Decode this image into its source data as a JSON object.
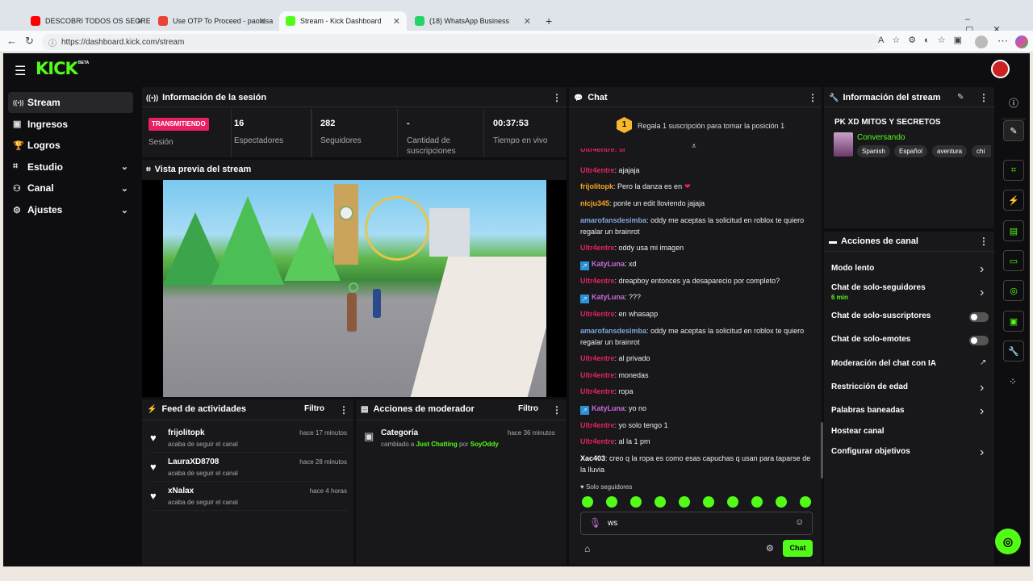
{
  "browser": {
    "tabs": [
      {
        "title": "DESCOBRI TODOS OS SEGREDOS",
        "icon": "youtube-icon",
        "color": "#ff0000"
      },
      {
        "title": "Use OTP To Proceed - paolosancoh",
        "icon": "gmail-icon",
        "color": "#ea4335"
      },
      {
        "title": "Stream - Kick Dashboard",
        "icon": "kick-icon",
        "color": "#53fc18"
      },
      {
        "title": "(18) WhatsApp Business",
        "icon": "whatsapp-icon",
        "color": "#25d366"
      }
    ],
    "url": "https://dashboard.kick.com/stream"
  },
  "brand": {
    "logo": "KICK",
    "badge": "BETA",
    "accent": "#53fc18"
  },
  "sidebar": {
    "items": [
      {
        "label": "Stream",
        "icon": "broadcast-icon"
      },
      {
        "label": "Ingresos",
        "icon": "wallet-icon"
      },
      {
        "label": "Logros",
        "icon": "trophy-icon"
      },
      {
        "label": "Estudio",
        "icon": "studio-icon"
      },
      {
        "label": "Canal",
        "icon": "channel-icon"
      },
      {
        "label": "Ajustes",
        "icon": "gear-icon"
      }
    ]
  },
  "session": {
    "title": "Información de la sesión",
    "status_badge": "TRANSMITIENDO",
    "status_label": "Sesión",
    "stats": [
      {
        "value": "16",
        "label": "Espectadores"
      },
      {
        "value": "282",
        "label": "Seguidores"
      },
      {
        "value": "-",
        "label": "Cantidad de suscripciones"
      },
      {
        "value": "00:37:53",
        "label": "Tiempo en vivo"
      }
    ]
  },
  "preview": {
    "title": "Vista previa del stream"
  },
  "feed": {
    "title": "Feed de actividades",
    "filter": "Filtro",
    "items": [
      {
        "name": "frijolitopk",
        "sub": "acaba de seguir el canal",
        "time": "hace 17 minutos"
      },
      {
        "name": "LauraXD8708",
        "sub": "acaba de seguir el canal",
        "time": "hace 28 minutos"
      },
      {
        "name": "xNalax",
        "sub": "acaba de seguir el canal",
        "time": "hace 4 horas"
      }
    ]
  },
  "modactions": {
    "title": "Acciones de moderador",
    "filter": "Filtro",
    "item": {
      "title": "Categoría",
      "pre": "cambiado a",
      "category": "Just Chatting",
      "by": "por",
      "user": "SoyOddy",
      "time": "hace 36 minutos"
    }
  },
  "chat": {
    "title": "Chat",
    "pinned_rank": "1",
    "pinned_text": "Regala 1 suscripción para tomar la posición 1",
    "messages": [
      {
        "user": "Ultr4entre",
        "text": "ajajaja",
        "color": "#e0245e"
      },
      {
        "user": "frijolitopk",
        "text": "Pero la danza es en",
        "color": "#f5a623"
      },
      {
        "user": "nicju345",
        "text": "ponle un edit lloviendo jajaja",
        "color": "#f5a623"
      },
      {
        "user": "amarofansdesimba",
        "text": "oddy me aceptas la solicitud en roblox te quiero regalar un brainrot",
        "color": "#7ea6e0"
      },
      {
        "user": "Ultr4entre",
        "text": "oddy usa mi imagen",
        "color": "#e0245e"
      },
      {
        "user": "KatyLuna",
        "text": "xd",
        "color": "#c86dd7"
      },
      {
        "user": "Ultr4entre",
        "text": "dreapboy entonces ya desaparecio por completo?",
        "color": "#e0245e"
      },
      {
        "user": "KatyLuna",
        "text": "???",
        "color": "#c86dd7"
      },
      {
        "user": "Ultr4entre",
        "text": "en whasapp",
        "color": "#e0245e"
      },
      {
        "user": "amarofansdesimba",
        "text": "oddy me aceptas la solicitud en roblox te quiero regalar un brainrot",
        "color": "#7ea6e0"
      },
      {
        "user": "Ultr4entre",
        "text": "al privado",
        "color": "#e0245e"
      },
      {
        "user": "Ultr4entre",
        "text": "monedas",
        "color": "#e0245e"
      },
      {
        "user": "Ultr4entre",
        "text": "ropa",
        "color": "#e0245e"
      },
      {
        "user": "KatyLuna",
        "text": "yo no",
        "color": "#c86dd7"
      },
      {
        "user": "Ultr4entre",
        "text": "yo solo tengo 1",
        "color": "#e0245e"
      },
      {
        "user": "Ultr4entre",
        "text": "al la 1 pm",
        "color": "#e0245e"
      },
      {
        "user": "Xac403",
        "text": "creo q la ropa es como esas capuchas q usan para taparse de la lluvia",
        "color": "#ffffff"
      }
    ],
    "followers_only": "Solo seguidores",
    "input_value": "ws",
    "send_label": "Chat"
  },
  "streaminfo": {
    "title": "Información del stream",
    "stream_title": "PK XD MITOS Y SECRETOS",
    "category": "Conversando",
    "tags": [
      "Spanish",
      "Español",
      "aventura",
      "chi"
    ]
  },
  "channel_actions": {
    "title": "Acciones de canal",
    "items": [
      {
        "label": "Modo lento",
        "sub": "",
        "control": "arrow"
      },
      {
        "label": "Chat de solo-seguidores",
        "sub": "6 min",
        "control": "arrow"
      },
      {
        "label": "Chat de solo-suscriptores",
        "sub": "",
        "control": "toggle"
      },
      {
        "label": "Chat de solo-emotes",
        "sub": "",
        "control": "toggle"
      },
      {
        "label": "Moderación del chat con IA",
        "sub": "",
        "control": "external"
      },
      {
        "label": "Restricción de edad",
        "sub": "",
        "control": "arrow"
      },
      {
        "label": "Palabras baneadas",
        "sub": "",
        "control": "arrow"
      },
      {
        "label": "Hostear canal",
        "sub": "",
        "control": "none"
      },
      {
        "label": "Configurar objetivos",
        "sub": "",
        "control": "arrow"
      }
    ]
  }
}
